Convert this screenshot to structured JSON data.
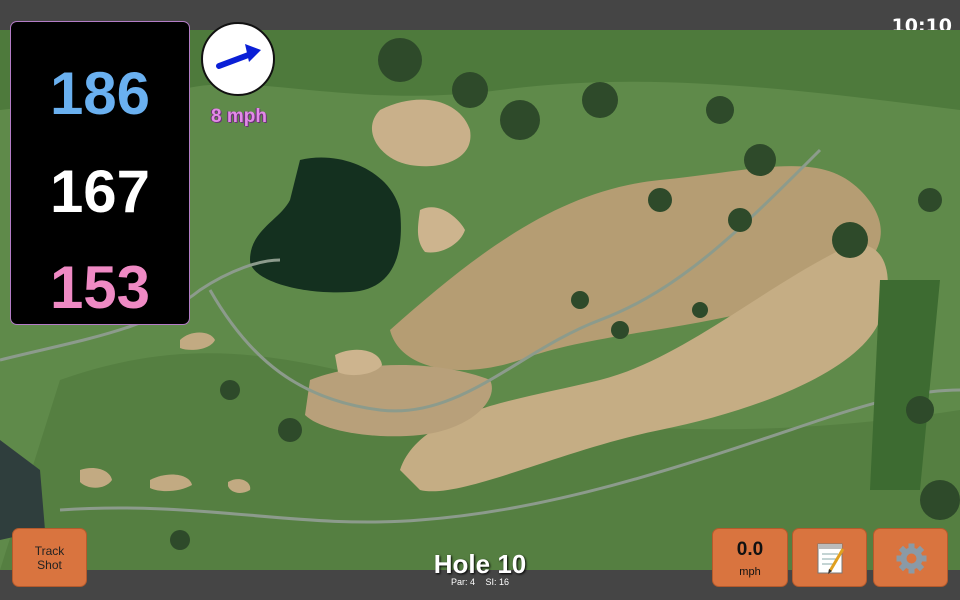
{
  "status": {
    "time": "10:10"
  },
  "distances": {
    "back": "186",
    "center": "167",
    "front": "153"
  },
  "wind": {
    "speed_label": "8 mph",
    "direction_icon": "arrow-icon"
  },
  "buttons": {
    "track_shot_line1": "Track",
    "track_shot_line2": "Shot",
    "speed_value": "0.0",
    "speed_unit": "mph",
    "notes_icon": "notepad-icon",
    "settings_icon": "gear-icon"
  },
  "hole": {
    "title": "Hole 10",
    "par": "Par: 4",
    "si": "SI: 16"
  },
  "colors": {
    "back": "#6ab0f0",
    "center": "#ffffff",
    "front": "#ef8ac4",
    "button": "#d9743f",
    "wind_text": "#e38ae8"
  }
}
